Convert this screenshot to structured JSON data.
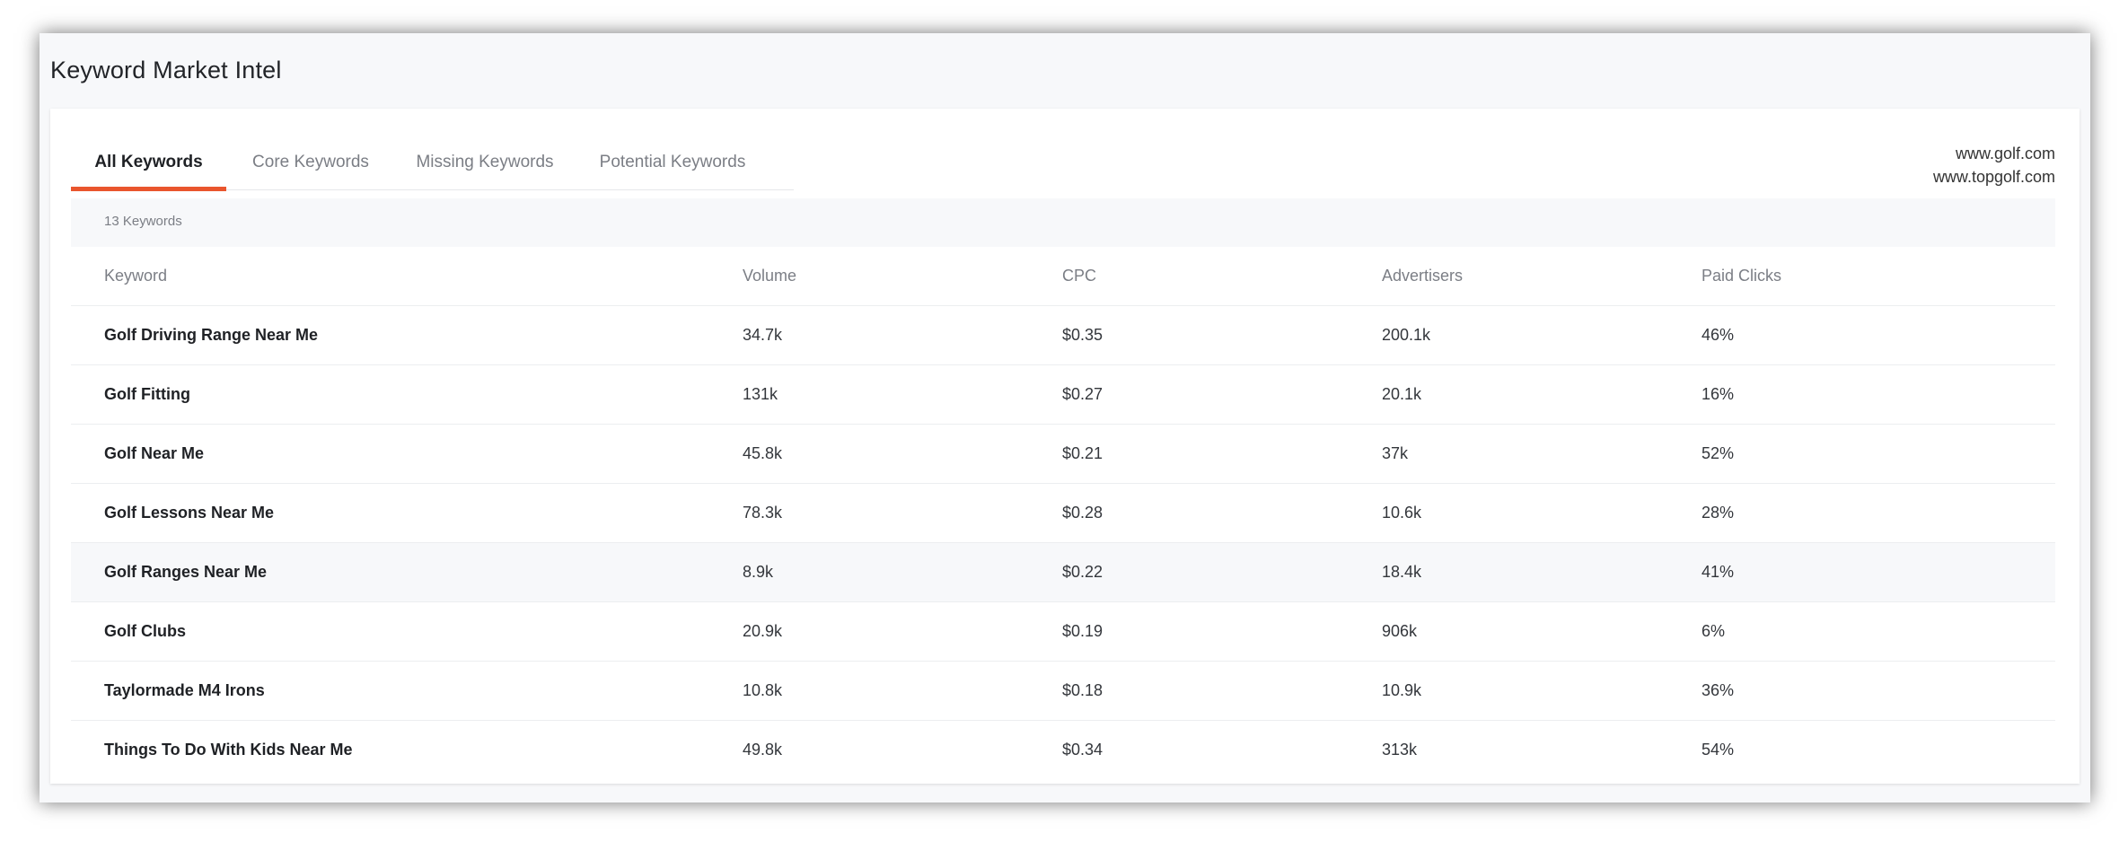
{
  "header": {
    "title": "Keyword Market Intel"
  },
  "tabs": [
    {
      "label": "All Keywords",
      "active": true
    },
    {
      "label": "Core Keywords",
      "active": false
    },
    {
      "label": "Missing Keywords",
      "active": false
    },
    {
      "label": "Potential Keywords",
      "active": false
    }
  ],
  "domains": [
    "www.golf.com",
    "www.topgolf.com"
  ],
  "summary": {
    "count_label": "13 Keywords"
  },
  "accent_color": "#e9552d",
  "table": {
    "columns": [
      "Keyword",
      "Volume",
      "CPC",
      "Advertisers",
      "Paid Clicks"
    ],
    "rows": [
      [
        "Golf Driving Range Near Me",
        "34.7k",
        "$0.35",
        "200.1k",
        "46%"
      ],
      [
        "Golf Fitting",
        "131k",
        "$0.27",
        "20.1k",
        "16%"
      ],
      [
        "Golf Near Me",
        "45.8k",
        "$0.21",
        "37k",
        "52%"
      ],
      [
        "Golf Lessons Near Me",
        "78.3k",
        "$0.28",
        "10.6k",
        "28%"
      ],
      [
        "Golf Ranges Near Me",
        "8.9k",
        "$0.22",
        "18.4k",
        "41%"
      ],
      [
        "Golf Clubs",
        "20.9k",
        "$0.19",
        "906k",
        "6%"
      ],
      [
        "Taylormade M4 Irons",
        "10.8k",
        "$0.18",
        "10.9k",
        "36%"
      ],
      [
        "Things To Do With Kids Near Me",
        "49.8k",
        "$0.34",
        "313k",
        "54%"
      ]
    ]
  }
}
